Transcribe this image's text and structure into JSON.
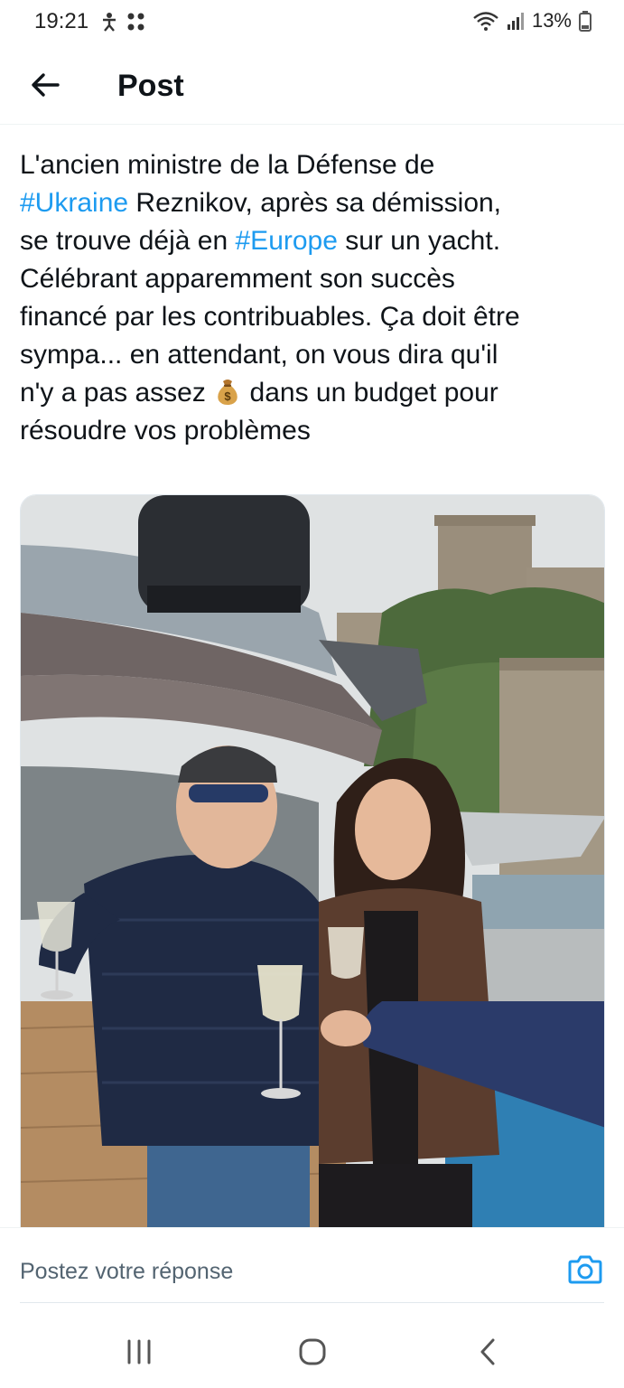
{
  "status_bar": {
    "time": "19:21",
    "battery": "13%",
    "icons": [
      "accessibility-icon",
      "apps-icon",
      "wifi-icon",
      "signal-icon",
      "battery-icon"
    ]
  },
  "header": {
    "title": "Post",
    "back_icon": "arrow-left-icon"
  },
  "post": {
    "line1": "L'ancien ministre de la Défense de",
    "tag_ukraine": "#Ukraine",
    "line2_rest": " Reznikov, après sa démission,",
    "line3_pre": "se trouve déjà en ",
    "tag_europe": "#Europe",
    "line3_post": " sur un yacht.",
    "line4": "Célébrant apparemment son succès",
    "line5": "financé par les contribuables. Ça doit être",
    "line6": "sympa... en attendant, on vous dira qu'il",
    "line7_pre": "n'y a pas assez ",
    "line7_post": " dans un budget pour",
    "line8": "résoudre vos problèmes",
    "emoji": "money-bag-icon"
  },
  "reply": {
    "placeholder": "Postez votre réponse",
    "camera_icon": "camera-icon"
  },
  "nav": {
    "icons": [
      "recent-apps-icon",
      "home-icon",
      "back-icon"
    ]
  },
  "colors": {
    "link": "#1d9bf0",
    "text": "#0f1419",
    "muted": "#536471"
  }
}
